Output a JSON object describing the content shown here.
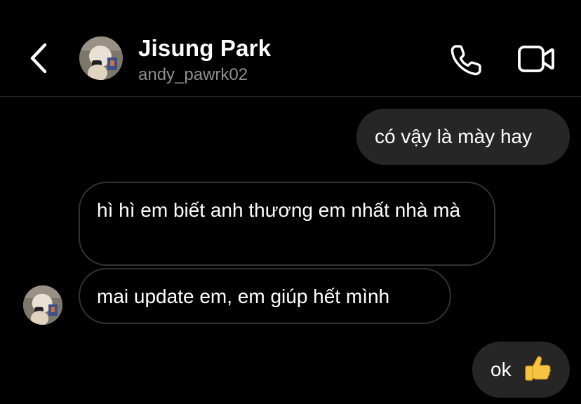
{
  "header": {
    "name": "Jisung Park",
    "username": "andy_pawrk02"
  },
  "messages": [
    {
      "direction": "outgoing",
      "text": "có vậy là mày hay"
    },
    {
      "direction": "incoming",
      "text": "hì hì em biết anh thương em nhất nhà mà"
    },
    {
      "direction": "incoming",
      "text": "mai update em, em giúp hết mình"
    },
    {
      "direction": "outgoing",
      "text": "ok",
      "emoji": "thumbs-up-icon"
    }
  ],
  "colors": {
    "background": "#000000",
    "outgoing_bubble": "#262626",
    "incoming_border": "#333333",
    "username": "#8e8e8e"
  },
  "icons": [
    "back-chevron-icon",
    "phone-icon",
    "video-camera-icon",
    "thumbs-up-icon"
  ]
}
